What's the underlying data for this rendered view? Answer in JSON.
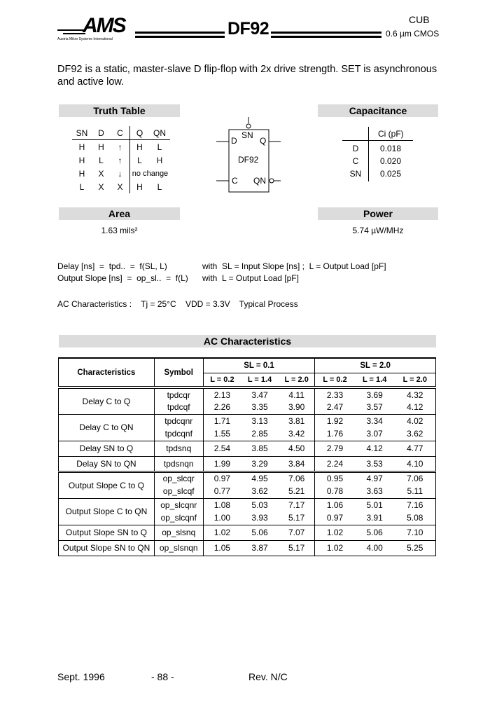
{
  "header": {
    "logo": "AMS",
    "logo_sub": "Austria Mikro Systeme International",
    "title": "DF92",
    "process_lib": "CUB",
    "technology": "0.6 µm CMOS"
  },
  "intro": "DF92 is a static, master-slave D flip-flop with 2x drive strength. SET is asynchronous and active low.",
  "truth_table": {
    "title": "Truth Table",
    "columns": [
      "SN",
      "D",
      "C",
      "Q",
      "QN"
    ],
    "rows": [
      [
        "H",
        "H",
        "↑",
        "H",
        "L"
      ],
      [
        "H",
        "L",
        "↑",
        "L",
        "H"
      ],
      [
        "H",
        "X",
        "↓",
        "no change",
        ""
      ],
      [
        "L",
        "X",
        "X",
        "H",
        "L"
      ]
    ]
  },
  "symbol": {
    "name": "DF92",
    "pins": {
      "d": "D",
      "sn": "SN",
      "q": "Q",
      "c": "C",
      "qn": "QN"
    }
  },
  "capacitance": {
    "title": "Capacitance",
    "column": "Ci (pF)",
    "rows": [
      {
        "pin": "D",
        "value": "0.018"
      },
      {
        "pin": "C",
        "value": "0.020"
      },
      {
        "pin": "SN",
        "value": "0.025"
      }
    ]
  },
  "area": {
    "title": "Area",
    "value": "1.63  mils²"
  },
  "power": {
    "title": "Power",
    "value": "5.74 µW/MHz"
  },
  "formulas": {
    "delay_lhs": "Delay [ns]  =  tpd..  =  f(SL, L)",
    "delay_rhs": "with  SL = Input Slope [ns] ;  L = Output Load [pF]",
    "slope_lhs": "Output Slope [ns]  =  op_sl..  =  f(L)",
    "slope_rhs": "with  L = Output Load [pF]"
  },
  "conditions": "AC Characteristics :    Tj = 25°C    VDD = 3.3V    Typical Process",
  "ac": {
    "title": "AC Characteristics",
    "col_characteristics": "Characteristics",
    "col_symbol": "Symbol",
    "sl_groups": [
      "SL = 0.1",
      "SL = 2.0"
    ],
    "loads": [
      "L = 0.2",
      "L = 1.4",
      "L = 2.0",
      "L = 0.2",
      "L = 1.4",
      "L = 2.0"
    ],
    "groups": [
      {
        "name": "Delay C to Q",
        "rows": [
          {
            "symbol": "tpdcqr",
            "values": [
              "2.13",
              "3.47",
              "4.11",
              "2.33",
              "3.69",
              "4.32"
            ]
          },
          {
            "symbol": "tpdcqf",
            "values": [
              "2.26",
              "3.35",
              "3.90",
              "2.47",
              "3.57",
              "4.12"
            ]
          }
        ]
      },
      {
        "name": "Delay C to QN",
        "rows": [
          {
            "symbol": "tpdcqnr",
            "values": [
              "1.71",
              "3.13",
              "3.81",
              "1.92",
              "3.34",
              "4.02"
            ]
          },
          {
            "symbol": "tpdcqnf",
            "values": [
              "1.55",
              "2.85",
              "3.42",
              "1.76",
              "3.07",
              "3.62"
            ]
          }
        ]
      },
      {
        "name": "Delay SN to Q",
        "rows": [
          {
            "symbol": "tpdsnq",
            "values": [
              "2.54",
              "3.85",
              "4.50",
              "2.79",
              "4.12",
              "4.77"
            ]
          }
        ]
      },
      {
        "name": "Delay SN to QN",
        "rows": [
          {
            "symbol": "tpdsnqn",
            "values": [
              "1.99",
              "3.29",
              "3.84",
              "2.24",
              "3.53",
              "4.10"
            ]
          }
        ]
      },
      {
        "name": "Output Slope C to Q",
        "rows": [
          {
            "symbol": "op_slcqr",
            "values": [
              "0.97",
              "4.95",
              "7.06",
              "0.95",
              "4.97",
              "7.06"
            ]
          },
          {
            "symbol": "op_slcqf",
            "values": [
              "0.77",
              "3.62",
              "5.21",
              "0.78",
              "3.63",
              "5.11"
            ]
          }
        ]
      },
      {
        "name": "Output Slope C to QN",
        "rows": [
          {
            "symbol": "op_slcqnr",
            "values": [
              "1.08",
              "5.03",
              "7.17",
              "1.06",
              "5.01",
              "7.16"
            ]
          },
          {
            "symbol": "op_slcqnf",
            "values": [
              "1.00",
              "3.93",
              "5.17",
              "0.97",
              "3.91",
              "5.08"
            ]
          }
        ]
      },
      {
        "name": "Output Slope SN to Q",
        "rows": [
          {
            "symbol": "op_slsnq",
            "values": [
              "1.02",
              "5.06",
              "7.07",
              "1.02",
              "5.06",
              "7.10"
            ]
          }
        ]
      },
      {
        "name": "Output Slope SN to QN",
        "rows": [
          {
            "symbol": "op_slsnqn",
            "values": [
              "1.05",
              "3.87",
              "5.17",
              "1.02",
              "4.00",
              "5.25"
            ]
          }
        ]
      }
    ]
  },
  "footer": {
    "date": "Sept. 1996",
    "page": "- 88 -",
    "rev": "Rev. N/C"
  }
}
